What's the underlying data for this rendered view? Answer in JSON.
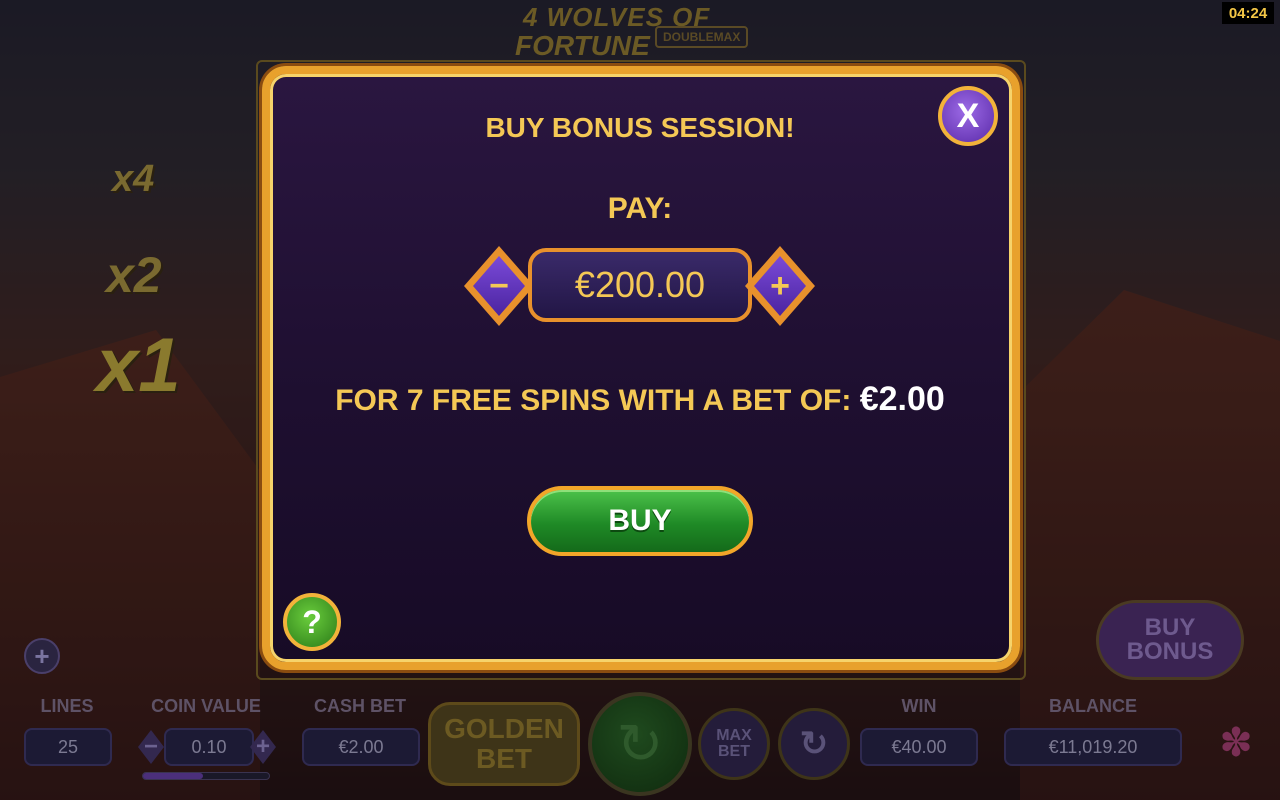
{
  "clock": "04:24",
  "logo": {
    "line1": "4 WOLVES OF",
    "line2": "FORTUNE",
    "badge": "DOUBLEMAX"
  },
  "multipliers": [
    "x4",
    "x2",
    "x1"
  ],
  "modal": {
    "title": "BUY BONUS SESSION!",
    "pay_label": "PAY:",
    "amount": "€200.00",
    "minus_label": "−",
    "plus_label": "+",
    "spins_text": "FOR 7 FREE SPINS WITH A BET OF:",
    "spins_bet": "€2.00",
    "buy_label": "BUY",
    "close_label": "X",
    "help_label": "?"
  },
  "hud": {
    "lines_label": "LINES",
    "lines_value": "25",
    "coin_value_label": "COIN VALUE",
    "coin_value": "0.10",
    "coin_minus": "−",
    "coin_plus": "+",
    "coin_level": 0.48,
    "cash_bet_label": "CASH BET",
    "cash_bet_value": "€2.00",
    "golden_bet_line1": "GOLDEN",
    "golden_bet_line2": "BET",
    "max_bet_line1": "MAX",
    "max_bet_line2": "BET",
    "win_label": "WIN",
    "win_value": "€40.00",
    "balance_label": "BALANCE",
    "balance_value": "€11,019.20",
    "buy_bonus_line1": "BUY",
    "buy_bonus_line2": "BONUS",
    "side_plus": "+"
  },
  "colors": {
    "accent_gold": "#f4c855",
    "frame_orange": "#e8a12c",
    "modal_purple": "#1e0f30",
    "buy_green": "#1f8a26"
  },
  "icons": {
    "close": "close-icon",
    "help": "help-icon",
    "spin": "spin-arrow-icon",
    "autoplay": "autoplay-icon",
    "brand": "yggdrasil-tree-icon"
  }
}
